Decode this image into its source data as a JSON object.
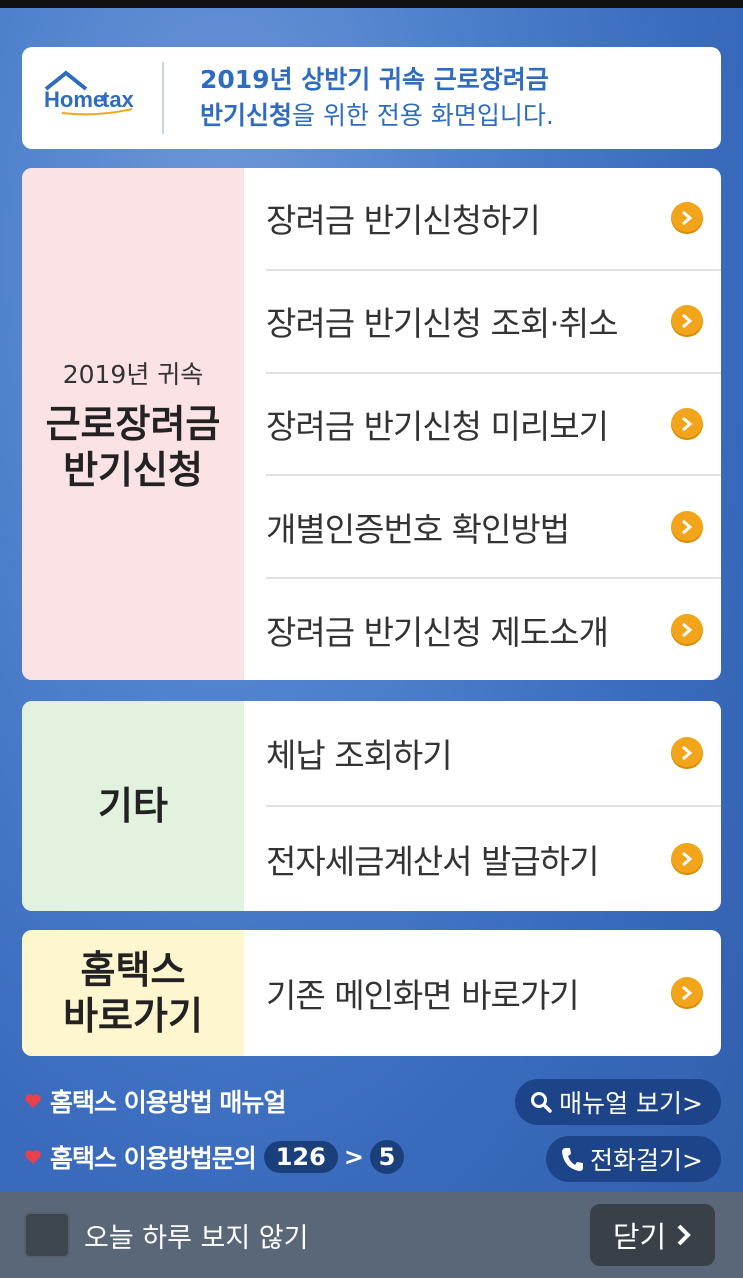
{
  "header": {
    "logo_text": "Hometax",
    "line1": "2019년 상반기 귀속 근로장려금",
    "line2_bold": "반기신청",
    "line2_rest": "을 위한 전용 화면입니다."
  },
  "section1": {
    "label_small": "2019년 귀속",
    "label_big_1": "근로장려금",
    "label_big_2": "반기신청",
    "items": [
      {
        "label": "장려금 반기신청하기"
      },
      {
        "label": "장려금 반기신청 조회·취소"
      },
      {
        "label": "장려금 반기신청 미리보기"
      },
      {
        "label": "개별인증번호 확인방법"
      },
      {
        "label": "장려금 반기신청 제도소개"
      }
    ]
  },
  "section2": {
    "label": "기타",
    "items": [
      {
        "label": "체납 조회하기"
      },
      {
        "label": "전자세금계산서 발급하기"
      }
    ]
  },
  "section3": {
    "label_1": "홈택스",
    "label_2": "바로가기",
    "items": [
      {
        "label": "기존 메인화면 바로가기"
      }
    ]
  },
  "info": {
    "manual_text": "홈택스 이용방법 매뉴얼",
    "manual_button": "매뉴얼 보기>",
    "inquiry_text": "홈택스 이용방법문의",
    "inquiry_number": "126",
    "inquiry_sep": ">",
    "inquiry_option": "5",
    "call_button": "전화걸기>"
  },
  "bottom": {
    "dont_show_today": "오늘 하루 보지 않기",
    "close_label": "닫기"
  },
  "colors": {
    "accent_orange": "#f2a51a",
    "header_blue": "#2d6cc0",
    "pill_navy": "#1d4489"
  }
}
